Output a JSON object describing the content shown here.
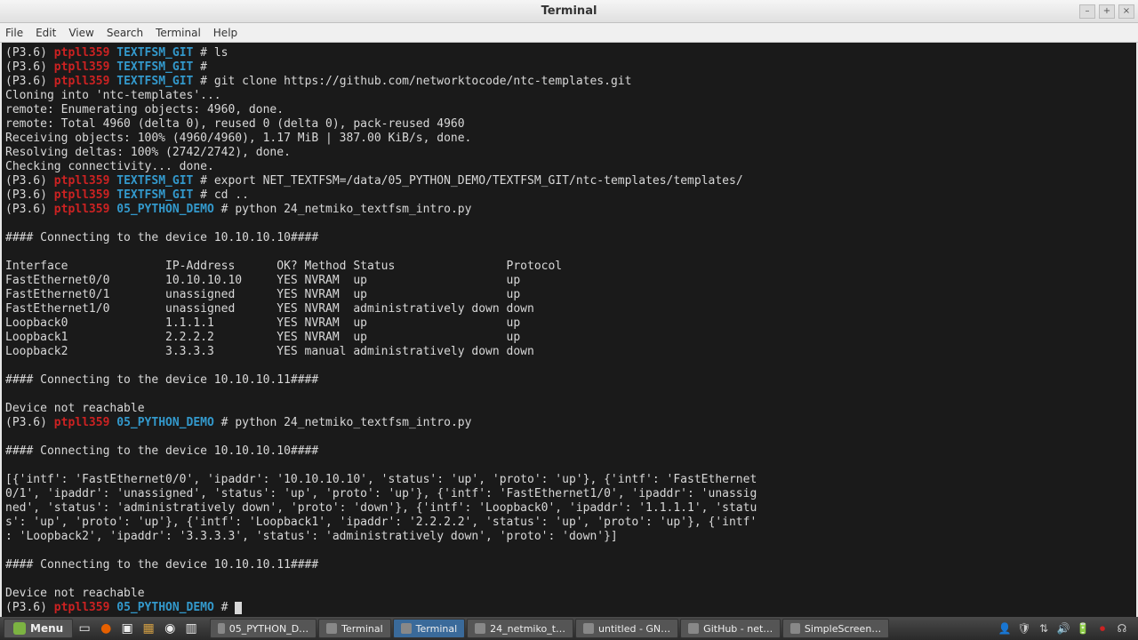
{
  "window": {
    "title": "Terminal"
  },
  "menubar": [
    "File",
    "Edit",
    "View",
    "Search",
    "Terminal",
    "Help"
  ],
  "prompt": {
    "venv": "(P3.6)",
    "host": "ptpll359",
    "path_textfsm": "TEXTFSM_GIT",
    "path_demo": "05_PYTHON_DEMO",
    "hash": " # "
  },
  "lines": {
    "l1_cmd": "ls",
    "l2_cmd": "",
    "l3_cmd": "git clone https://github.com/networktocode/ntc-templates.git",
    "l4": "Cloning into 'ntc-templates'...",
    "l5": "remote: Enumerating objects: 4960, done.",
    "l6": "remote: Total 4960 (delta 0), reused 0 (delta 0), pack-reused 4960",
    "l7": "Receiving objects: 100% (4960/4960), 1.17 MiB | 387.00 KiB/s, done.",
    "l8": "Resolving deltas: 100% (2742/2742), done.",
    "l9": "Checking connectivity... done.",
    "l10_cmd": "export NET_TEXTFSM=/data/05_PYTHON_DEMO/TEXTFSM_GIT/ntc-templates/templates/",
    "l11_cmd": "cd ..",
    "l12_cmd": "python 24_netmiko_textfsm_intro.py",
    "blank": "",
    "l13": "#### Connecting to the device 10.10.10.10####",
    "l14": "Interface              IP-Address      OK? Method Status                Protocol",
    "l15": "FastEthernet0/0        10.10.10.10     YES NVRAM  up                    up",
    "l16": "FastEthernet0/1        unassigned      YES NVRAM  up                    up",
    "l17": "FastEthernet1/0        unassigned      YES NVRAM  administratively down down",
    "l18": "Loopback0              1.1.1.1         YES NVRAM  up                    up",
    "l19": "Loopback1              2.2.2.2         YES NVRAM  up                    up",
    "l20": "Loopback2              3.3.3.3         YES manual administratively down down",
    "l21": "#### Connecting to the device 10.10.10.11####",
    "l22": "Device not reachable",
    "l23_cmd": "python 24_netmiko_textfsm_intro.py",
    "l24": "#### Connecting to the device 10.10.10.10####",
    "l25": "[{'intf': 'FastEthernet0/0', 'ipaddr': '10.10.10.10', 'status': 'up', 'proto': 'up'}, {'intf': 'FastEthernet",
    "l26": "0/1', 'ipaddr': 'unassigned', 'status': 'up', 'proto': 'up'}, {'intf': 'FastEthernet1/0', 'ipaddr': 'unassig",
    "l27": "ned', 'status': 'administratively down', 'proto': 'down'}, {'intf': 'Loopback0', 'ipaddr': '1.1.1.1', 'statu",
    "l28": "s': 'up', 'proto': 'up'}, {'intf': 'Loopback1', 'ipaddr': '2.2.2.2', 'status': 'up', 'proto': 'up'}, {'intf'",
    "l29": ": 'Loopback2', 'ipaddr': '3.3.3.3', 'status': 'administratively down', 'proto': 'down'}]",
    "l30": "#### Connecting to the device 10.10.10.11####",
    "l31": "Device not reachable"
  },
  "taskbar": {
    "menu": "Menu",
    "items": [
      {
        "label": "05_PYTHON_D…",
        "active": false
      },
      {
        "label": "Terminal",
        "active": false
      },
      {
        "label": "Terminal",
        "active": true
      },
      {
        "label": "24_netmiko_t…",
        "active": false
      },
      {
        "label": "untitled - GN…",
        "active": false
      },
      {
        "label": "GitHub - net…",
        "active": false
      },
      {
        "label": "SimpleScreen…",
        "active": false
      }
    ]
  }
}
